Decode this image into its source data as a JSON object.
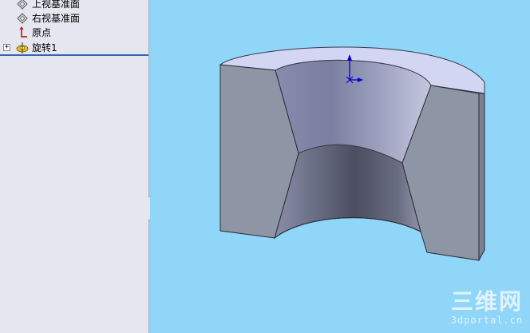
{
  "feature_tree": {
    "items": [
      {
        "label": "上视基准面",
        "icon": "plane-icon"
      },
      {
        "label": "右视基准面",
        "icon": "plane-icon"
      },
      {
        "label": "原点",
        "icon": "origin-icon"
      },
      {
        "label": "旋转1",
        "icon": "revolve-feature-icon",
        "expander": "+"
      }
    ]
  },
  "watermark": {
    "logo": "三维网",
    "url": "3dportal.cn"
  },
  "colors": {
    "viewport_background": "#8fd6f8",
    "tree_background": "#e4e7ef",
    "model_gray": "#8e96a6",
    "model_top": "#d2d6f2",
    "origin_blue": "#0000cc"
  }
}
